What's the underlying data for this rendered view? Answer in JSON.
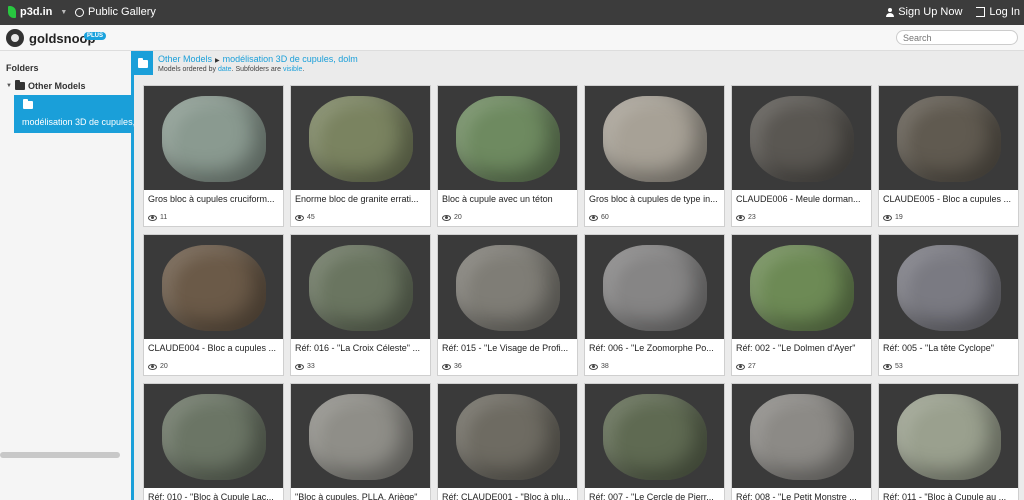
{
  "topbar": {
    "logo": "p3d.in",
    "gallery": "Public Gallery",
    "signup": "Sign Up Now",
    "login": "Log In"
  },
  "user": {
    "name": "goldsnoop",
    "badge": "PLUS",
    "search_placeholder": "Search"
  },
  "sidebar": {
    "title": "Folders",
    "folder": "Other Models",
    "selected": "modélisation 3D de cupules, dolm"
  },
  "breadcrumb": {
    "root": "Other Models",
    "current": "modélisation 3D de cupules, dolm",
    "order_prefix": "Models ordered by",
    "order_link": "date",
    "order_mid": ". Subfolders are",
    "order_vis": "visible",
    "order_end": "."
  },
  "accent": "#1a9fd9",
  "models": [
    {
      "title": "Gros bloc à cupules cruciform...",
      "views": "11",
      "color": "#8a9a90"
    },
    {
      "title": "Enorme bloc de granite errati...",
      "views": "45",
      "color": "#7a8360"
    },
    {
      "title": "Bloc à cupule avec un téton",
      "views": "20",
      "color": "#6e8a60"
    },
    {
      "title": "Gros bloc à cupules de type in...",
      "views": "60",
      "color": "#a7a196"
    },
    {
      "title": "CLAUDE006 - Meule dorman...",
      "views": "23",
      "color": "#5a5752"
    },
    {
      "title": "CLAUDE005 - Bloc a cupules ...",
      "views": "19",
      "color": "#605a50"
    },
    {
      "title": "CLAUDE004 - Bloc a cupules ...",
      "views": "20",
      "color": "#6b5a48"
    },
    {
      "title": "Réf: 016 - \"La Croix Céleste\" ...",
      "views": "33",
      "color": "#6a7560"
    },
    {
      "title": "Réf: 015 - \"Le Visage de Profi...",
      "views": "36",
      "color": "#7f7d76"
    },
    {
      "title": "Réf: 006 - \"Le Zoomorphe Po...",
      "views": "38",
      "color": "#868585"
    },
    {
      "title": "Réf: 002 - \"Le Dolmen d'Ayer\"",
      "views": "27",
      "color": "#6d8a55"
    },
    {
      "title": "Réf: 005 - \"La tête Cyclope\"",
      "views": "53",
      "color": "#7a7a82"
    },
    {
      "title": "Réf: 010 - \"Bloc à Cupule Lac...",
      "views": "",
      "color": "#6b7565"
    },
    {
      "title": "\"Bloc à cupules. PLLA. Ariège\"",
      "views": "",
      "color": "#8f8e88"
    },
    {
      "title": "Réf: CLAUDE001 - \"Bloc à plu...",
      "views": "",
      "color": "#6e6b62"
    },
    {
      "title": "Réf: 007 - \"Le Cercle de Pierr...",
      "views": "",
      "color": "#5f6a52"
    },
    {
      "title": "Réf: 008 - \"Le Petit Monstre ...",
      "views": "",
      "color": "#8c8a86"
    },
    {
      "title": "Réf: 011 - \"Bloc à Cupule au ...",
      "views": "",
      "color": "#9aa08e"
    }
  ]
}
